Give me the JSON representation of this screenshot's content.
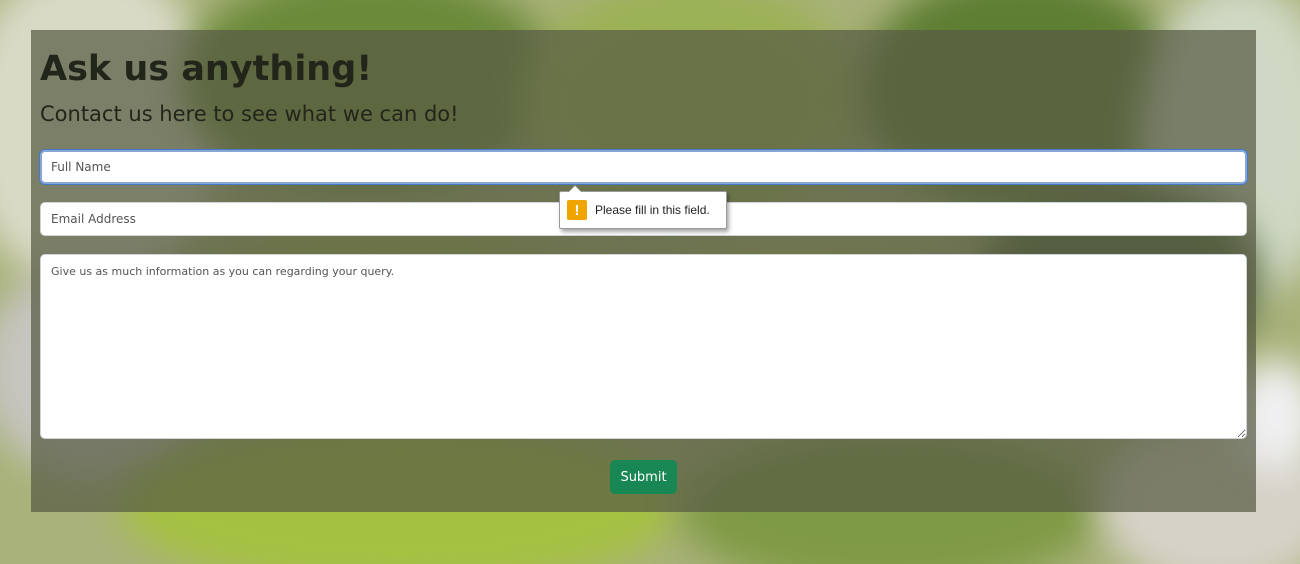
{
  "contact": {
    "heading": "Ask us anything!",
    "subheading": "Contact us here to see what we can do!",
    "name_placeholder": "Full Name",
    "email_placeholder": "Email Address",
    "message_placeholder": "Give us as much information as you can regarding your query.",
    "submit_label": "Submit"
  },
  "validation_tooltip": {
    "icon": "warning-icon",
    "text": "Please fill in this field."
  },
  "colors": {
    "submit": "#198754",
    "warning": "#f0a400",
    "focus_border": "#4a78c2"
  }
}
